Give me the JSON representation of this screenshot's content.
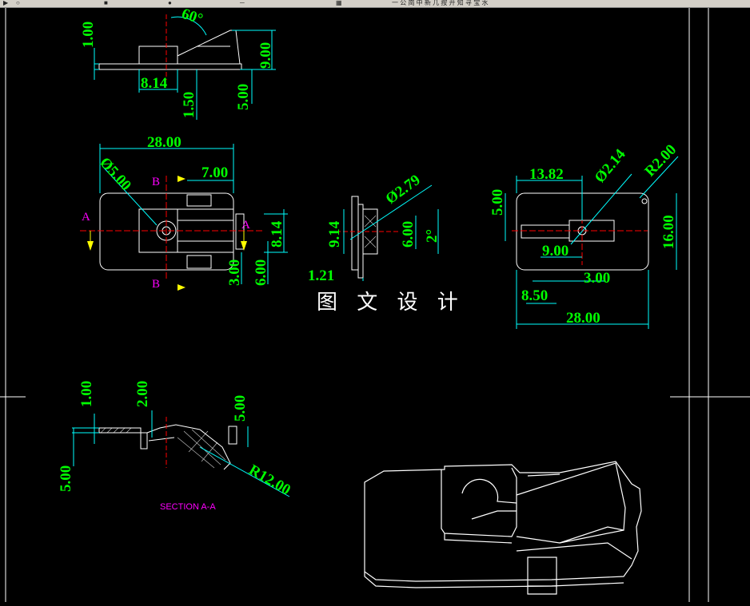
{
  "toolbar": {
    "icons": [
      "arrow-icon",
      "magnifier-icon",
      "layer-icon",
      "color-icon",
      "line-icon",
      "style-icon"
    ],
    "status_text": "一 公 崗 中 新 几 按 开 知 寻 宝 水"
  },
  "colors": {
    "background": "#000000",
    "geometry": "#ffffff",
    "dimension_line": "#00ffff",
    "dimension_text": "#00ff00",
    "centerline": "#ff0000",
    "section_label": "#ff00ff",
    "section_arrow": "#ffff00"
  },
  "views": {
    "side_view": {
      "dims": [
        "1.00",
        "60°",
        "9.00",
        "8.14",
        "1.50",
        "5.00"
      ]
    },
    "top_view": {
      "dims": [
        "28.00",
        "Ø5.00",
        "7.00",
        "8.14",
        "6.00",
        "3.00"
      ],
      "section_labels": [
        "A",
        "A",
        "B",
        "B"
      ]
    },
    "section_b": {
      "dims": [
        "Ø2.79",
        "9.14",
        "6.00",
        "2°",
        "1.21"
      ]
    },
    "bottom_view": {
      "dims": [
        "13.82",
        "Ø2.14",
        "R2.00",
        "5.00",
        "16.00",
        "9.00",
        "3.00",
        "8.50",
        "28.00"
      ]
    },
    "section_a": {
      "dims": [
        "1.00",
        "2.00",
        "5.00",
        "5.00",
        "R12.00"
      ],
      "title": "SECTION A-A"
    },
    "isometric": {}
  },
  "watermark": "图 文 设 计"
}
